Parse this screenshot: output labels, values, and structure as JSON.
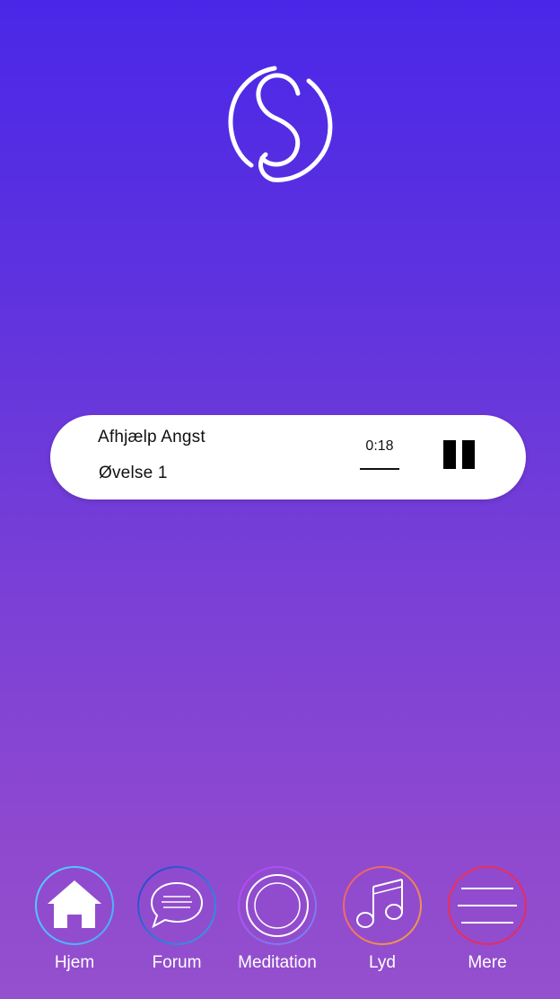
{
  "player": {
    "title": "Afhjælp Angst",
    "subtitle": "Øvelse 1",
    "time": "0:18"
  },
  "nav": {
    "items": [
      {
        "id": "home",
        "label": "Hjem",
        "icon": "home-icon",
        "active": true
      },
      {
        "id": "forum",
        "label": "Forum",
        "icon": "chat-bubble-icon",
        "active": false
      },
      {
        "id": "meditation",
        "label": "Meditation",
        "icon": "circle-icon",
        "active": false
      },
      {
        "id": "sound",
        "label": "Lyd",
        "icon": "music-note-icon",
        "active": false
      },
      {
        "id": "more",
        "label": "Mere",
        "icon": "menu-lines-icon",
        "active": false
      }
    ]
  },
  "colors": {
    "gradient_top": "#4a27e8",
    "gradient_bottom": "#9450cd",
    "player_bg": "#ffffff",
    "text_dark": "#111111",
    "icon_white": "#ffffff",
    "ring_home": "#56d1ff",
    "ring_forum": "#2a6ae0",
    "ring_meditation": "#c23ef0",
    "ring_sound": "#f0586a",
    "ring_more": "#f0304f"
  }
}
